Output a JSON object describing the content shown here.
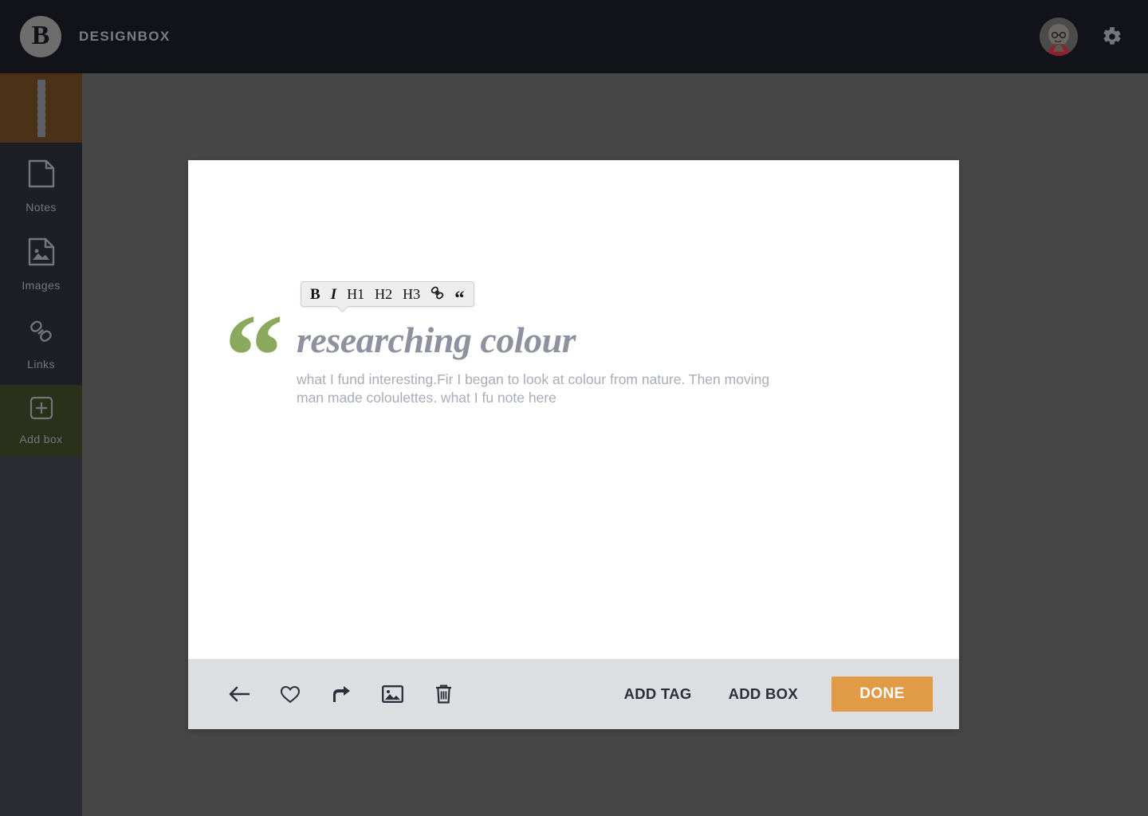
{
  "header": {
    "logo_letter": "B",
    "title": "DESIGNBOX",
    "avatar_name": "user-avatar",
    "settings_icon": "gear-icon"
  },
  "sidebar": {
    "items": [
      {
        "id": "grid",
        "label": "",
        "icon": "grid-icon",
        "active": true
      },
      {
        "id": "notes",
        "label": "Notes",
        "icon": "note-icon",
        "active": false
      },
      {
        "id": "images",
        "label": "Images",
        "icon": "image-icon",
        "active": false
      },
      {
        "id": "links",
        "label": "Links",
        "icon": "link-icon",
        "active": false
      },
      {
        "id": "addbox",
        "label": "Add  box",
        "icon": "plus-box-icon",
        "active": true
      }
    ]
  },
  "format_toolbar": {
    "items": [
      {
        "id": "bold",
        "label": "B",
        "icon": "bold-icon"
      },
      {
        "id": "italic",
        "label": "I",
        "icon": "italic-icon"
      },
      {
        "id": "h1",
        "label": "H1",
        "icon": "heading-1-icon"
      },
      {
        "id": "h2",
        "label": "H2",
        "icon": "heading-2-icon"
      },
      {
        "id": "h3",
        "label": "H3",
        "icon": "heading-3-icon"
      },
      {
        "id": "link",
        "label": "",
        "icon": "link-icon"
      },
      {
        "id": "quote",
        "label": "“",
        "icon": "quote-icon"
      }
    ]
  },
  "note": {
    "quote_mark": "“",
    "heading": "researching colour",
    "body": "what I fund interesting.Fir I began to look at colour from nature. Then moving man made coloulettes. what I fu note here"
  },
  "footer": {
    "tools": [
      {
        "id": "back",
        "icon": "back-arrow-icon"
      },
      {
        "id": "like",
        "icon": "heart-icon"
      },
      {
        "id": "share",
        "icon": "share-icon"
      },
      {
        "id": "image",
        "icon": "image-icon"
      },
      {
        "id": "delete",
        "icon": "trash-icon"
      }
    ],
    "add_tag_label": "ADD TAG",
    "add_box_label": "ADD BOX",
    "done_label": "DONE"
  },
  "colors": {
    "header_bg": "#121319",
    "sidebar_bg": "#1d1f24",
    "sidebar_active_brown": "#4a3118",
    "sidebar_active_green": "#2a3019",
    "canvas_bg": "#474747",
    "card_bg": "#ffffff",
    "footer_bg": "#dcdee1",
    "accent_orange": "#e19a46",
    "quote_green": "#8aa95c",
    "heading_gray": "#8d929e",
    "body_gray": "#a8adb8"
  }
}
